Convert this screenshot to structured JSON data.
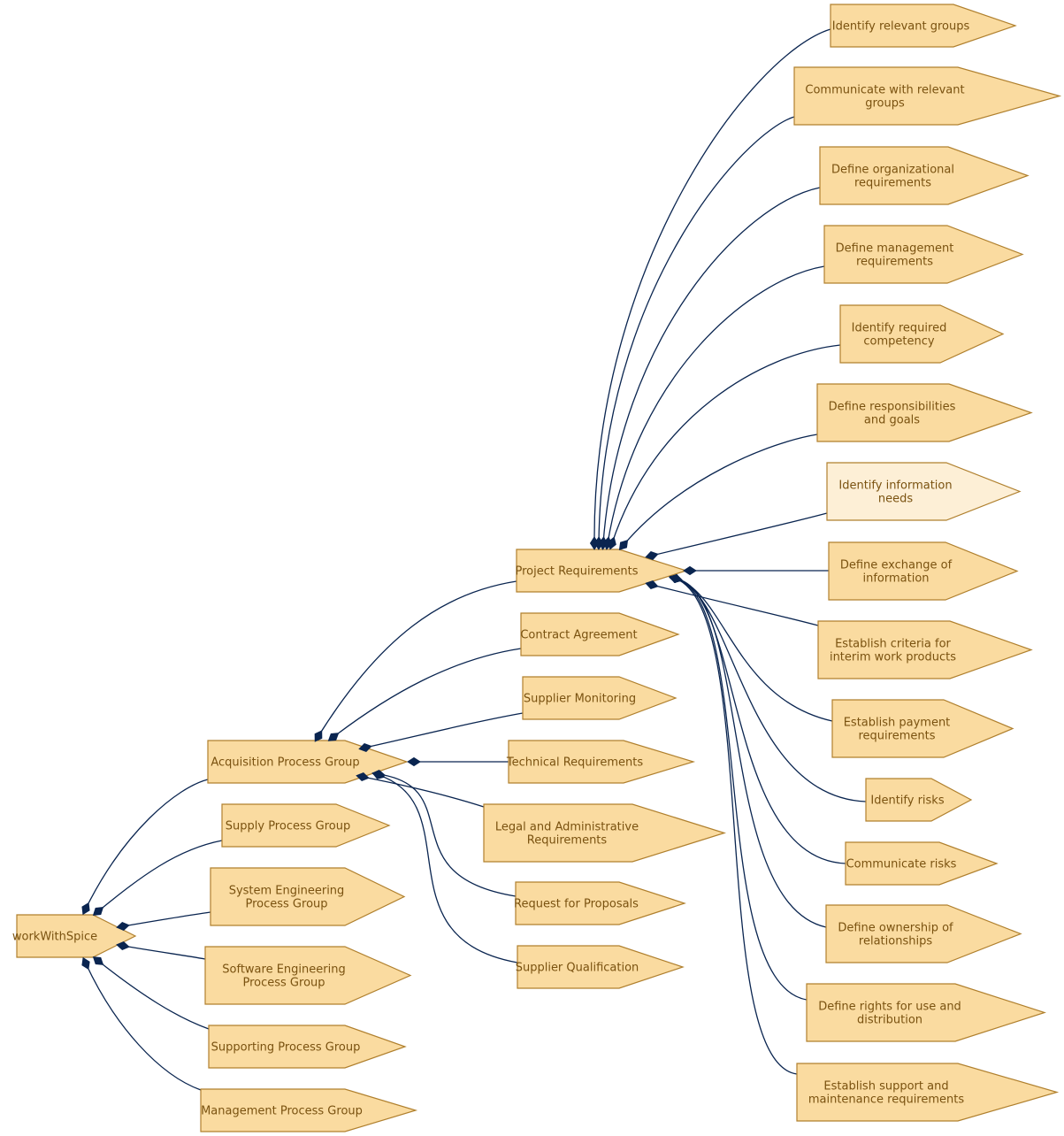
{
  "diagram": {
    "title": "workWithSpice",
    "colors": {
      "node_fill": "#fadba0",
      "node_fill_highlight": "#fdefd6",
      "node_stroke": "#b0802e",
      "label_text": "#7a5210",
      "edge": "#0a2550"
    },
    "nodes": [
      {
        "id": "root",
        "lines": [
          "workWithSpice"
        ]
      },
      {
        "id": "acq",
        "lines": [
          "Acquisition Process Group"
        ]
      },
      {
        "id": "supply",
        "lines": [
          "Supply Process Group"
        ]
      },
      {
        "id": "syseng",
        "lines": [
          "System Engineering",
          "Process Group"
        ]
      },
      {
        "id": "sweng",
        "lines": [
          "Software Engineering",
          "Process Group"
        ]
      },
      {
        "id": "supporting",
        "lines": [
          "Supporting Process Group"
        ]
      },
      {
        "id": "mgmt",
        "lines": [
          "Management Process Group"
        ]
      },
      {
        "id": "projreq",
        "lines": [
          "Project Requirements"
        ]
      },
      {
        "id": "contract",
        "lines": [
          "Contract Agreement"
        ]
      },
      {
        "id": "supmon",
        "lines": [
          "Supplier Monitoring"
        ]
      },
      {
        "id": "techreq",
        "lines": [
          "Technical Requirements"
        ]
      },
      {
        "id": "legal",
        "lines": [
          "Legal and Administrative",
          "Requirements"
        ]
      },
      {
        "id": "rfp",
        "lines": [
          "Request for Proposals"
        ]
      },
      {
        "id": "supqual",
        "lines": [
          "Supplier Qualification"
        ]
      },
      {
        "id": "p1",
        "lines": [
          "Identify relevant groups"
        ]
      },
      {
        "id": "p2",
        "lines": [
          "Communicate with relevant",
          "groups"
        ]
      },
      {
        "id": "p3",
        "lines": [
          "Define organizational",
          "requirements"
        ]
      },
      {
        "id": "p4",
        "lines": [
          "Define management",
          "requirements"
        ]
      },
      {
        "id": "p5",
        "lines": [
          "Identify required",
          "competency"
        ]
      },
      {
        "id": "p6",
        "lines": [
          "Define responsibilities",
          "and goals"
        ]
      },
      {
        "id": "p7",
        "lines": [
          "Identify information",
          "needs"
        ],
        "highlight": true
      },
      {
        "id": "p8",
        "lines": [
          "Define exchange of",
          "information"
        ]
      },
      {
        "id": "p9",
        "lines": [
          "Establish criteria for",
          "interim work products"
        ]
      },
      {
        "id": "p10",
        "lines": [
          "Establish payment",
          "requirements"
        ]
      },
      {
        "id": "p11",
        "lines": [
          "Identify risks"
        ]
      },
      {
        "id": "p12",
        "lines": [
          "Communicate risks"
        ]
      },
      {
        "id": "p13",
        "lines": [
          "Define ownership of",
          "relationships"
        ]
      },
      {
        "id": "p14",
        "lines": [
          "Define rights for use and",
          "distribution"
        ]
      },
      {
        "id": "p15",
        "lines": [
          "Establish support and",
          "maintenance requirements"
        ]
      }
    ],
    "edges": [
      {
        "from": "root",
        "to": "acq",
        "type": "composition"
      },
      {
        "from": "root",
        "to": "supply",
        "type": "composition"
      },
      {
        "from": "root",
        "to": "syseng",
        "type": "composition"
      },
      {
        "from": "root",
        "to": "sweng",
        "type": "composition"
      },
      {
        "from": "root",
        "to": "supporting",
        "type": "composition"
      },
      {
        "from": "root",
        "to": "mgmt",
        "type": "composition"
      },
      {
        "from": "acq",
        "to": "projreq",
        "type": "composition"
      },
      {
        "from": "acq",
        "to": "contract",
        "type": "composition"
      },
      {
        "from": "acq",
        "to": "supmon",
        "type": "composition"
      },
      {
        "from": "acq",
        "to": "techreq",
        "type": "composition"
      },
      {
        "from": "acq",
        "to": "legal",
        "type": "composition"
      },
      {
        "from": "acq",
        "to": "rfp",
        "type": "composition"
      },
      {
        "from": "acq",
        "to": "supqual",
        "type": "composition"
      },
      {
        "from": "projreq",
        "to": "p1",
        "type": "composition"
      },
      {
        "from": "projreq",
        "to": "p2",
        "type": "composition"
      },
      {
        "from": "projreq",
        "to": "p3",
        "type": "composition"
      },
      {
        "from": "projreq",
        "to": "p4",
        "type": "composition"
      },
      {
        "from": "projreq",
        "to": "p5",
        "type": "composition"
      },
      {
        "from": "projreq",
        "to": "p6",
        "type": "composition"
      },
      {
        "from": "projreq",
        "to": "p7",
        "type": "composition"
      },
      {
        "from": "projreq",
        "to": "p8",
        "type": "composition"
      },
      {
        "from": "projreq",
        "to": "p9",
        "type": "composition"
      },
      {
        "from": "projreq",
        "to": "p10",
        "type": "composition"
      },
      {
        "from": "projreq",
        "to": "p11",
        "type": "composition"
      },
      {
        "from": "projreq",
        "to": "p12",
        "type": "composition"
      },
      {
        "from": "projreq",
        "to": "p13",
        "type": "composition"
      },
      {
        "from": "projreq",
        "to": "p14",
        "type": "composition"
      },
      {
        "from": "projreq",
        "to": "p15",
        "type": "composition"
      }
    ]
  }
}
